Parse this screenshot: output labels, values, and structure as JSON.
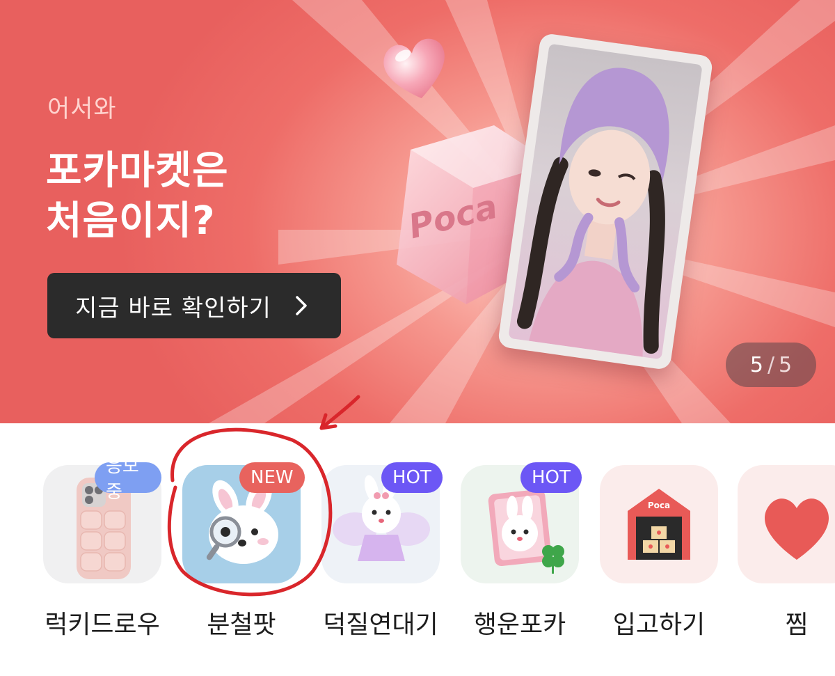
{
  "banner": {
    "welcome": "어서와",
    "headline_line1": "포카마켓은",
    "headline_line2": "처음이지?",
    "cta_label": "지금 바로 확인하기",
    "cube_text": "Poca",
    "pager": {
      "current": "5",
      "separator": "/",
      "total": "5"
    },
    "colors": {
      "background": "#ee6d68",
      "cta": "#2b2b2b"
    }
  },
  "categories": [
    {
      "label": "럭키드로우",
      "badge": "응모중",
      "icon": "phone-case-icon"
    },
    {
      "label": "분철팟",
      "badge": "NEW",
      "icon": "bunny-magnifier-icon"
    },
    {
      "label": "덕질연대기",
      "badge": "HOT",
      "icon": "fairy-bunny-icon"
    },
    {
      "label": "행운포카",
      "badge": "HOT",
      "icon": "lucky-card-bunny-icon"
    },
    {
      "label": "입고하기",
      "badge": "",
      "icon": "poca-warehouse-icon"
    },
    {
      "label": "찜",
      "badge": "",
      "icon": "heart-icon"
    }
  ],
  "badge_colors": {
    "응모중": "#7e9ff2",
    "NEW": "#e8635e",
    "HOT": "#6c57f5"
  },
  "annotation": {
    "color": "#d9262b"
  }
}
